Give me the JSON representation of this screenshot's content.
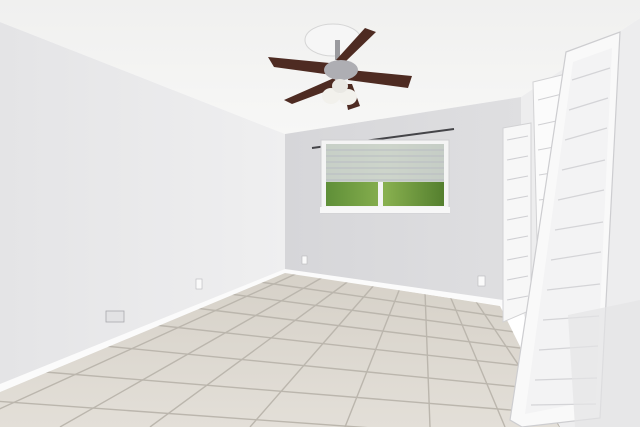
{
  "scene": {
    "subject": "empty-room",
    "colors": {
      "ceiling": "#f4f4f3",
      "left_wall": "#e9e9ea",
      "back_wall": "#dcdcde",
      "right_wall": "#ececec",
      "floor": "#dedad3",
      "grout": "#b9b4ab",
      "baseboard": "#fbfbfb",
      "fan_blade": "#4e2b22",
      "window_green": "#6a9a3a",
      "door": "#f7f7f7"
    }
  }
}
